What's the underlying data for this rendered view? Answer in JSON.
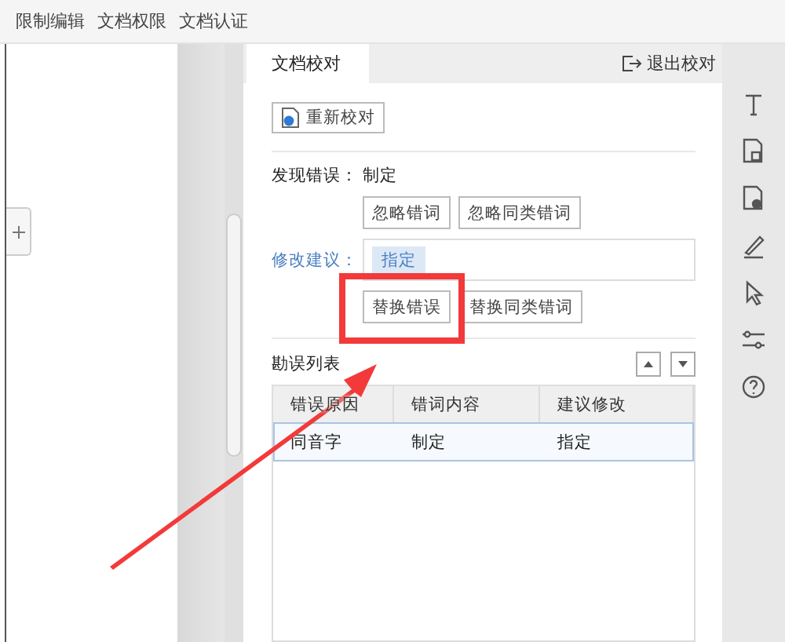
{
  "menu": [
    "限制编辑",
    "文档权限",
    "文档认证"
  ],
  "panel": {
    "tabs": [
      {
        "label": "文档校对",
        "selected": true
      }
    ],
    "exit": "退出校对",
    "recheck": "重新校对",
    "found_label": "发现错误：",
    "found_value": "制定",
    "ignore_buttons": [
      "忽略错词",
      "忽略同类错词"
    ],
    "suggest_label": "修改建议：",
    "suggestions": [
      {
        "text": "指定",
        "selected": true
      }
    ],
    "replace_buttons": [
      "替换错误",
      "替换同类错词"
    ],
    "list_title": "勘误列表",
    "table": {
      "columns": [
        "错误原因",
        "错词内容",
        "建议修改"
      ],
      "rows": [
        {
          "cells": [
            "同音字",
            "制定",
            "指定"
          ],
          "selected": true
        }
      ]
    }
  }
}
